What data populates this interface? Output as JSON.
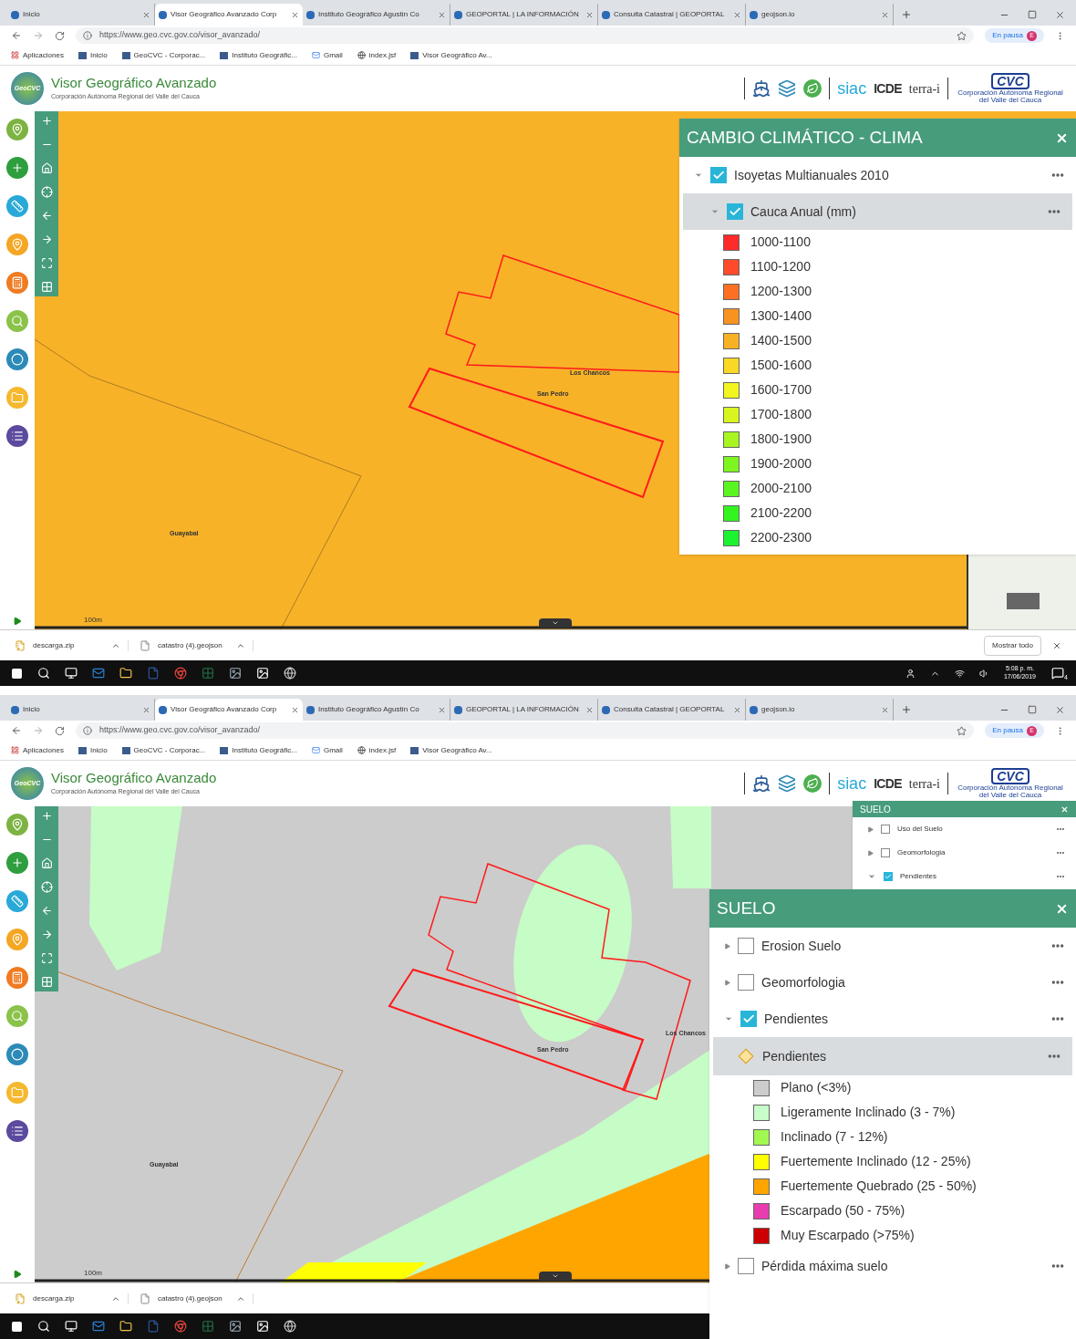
{
  "screens": [
    {
      "tabs": [
        {
          "label": "Inicio",
          "selected": false
        },
        {
          "label": "Visor Geográfico Avanzado Corp",
          "selected": true
        },
        {
          "label": "Instituto Geográfico Agustín Co",
          "selected": false
        },
        {
          "label": "GEOPORTAL | LA INFORMACIÓN",
          "selected": false
        },
        {
          "label": "Consulta Catastral | GEOPORTAL",
          "selected": false
        },
        {
          "label": "geojson.io",
          "selected": false
        }
      ],
      "url": "https://www.geo.cvc.gov.co/visor_avanzado/",
      "pause_label": "En pausa",
      "profile_initial": "E",
      "bookmarks": [
        "Aplicaciones",
        "Inicio",
        "GeoCVC - Corporac...",
        "Instituto Geográfic...",
        "Gmail",
        "index.jsf",
        "Visor Geográfico Av..."
      ],
      "app": {
        "logo_text": "GeoCVC",
        "title": "Visor Geográfico Avanzado",
        "subtitle": "Corporación Autónoma Regional del Valle del Cauca",
        "partners": [
          "siac",
          "ICDE",
          "terra-i",
          "CVC"
        ],
        "cvc_caption": "Corporación Autónoma Regional del Valle del Cauca"
      },
      "map": {
        "kind": "rainfall",
        "labels": [
          "Los Chancos",
          "San Pedro",
          "Guayabal"
        ],
        "scale": "100m"
      },
      "panels": [
        {
          "kind": "full",
          "title": "CAMBIO CLIMÁTICO - CLIMA",
          "items": [
            {
              "kind": "layer",
              "label": "Isoyetas Multianuales 2010",
              "checked": true,
              "expanded": true,
              "highlighted": false,
              "children": [
                {
                  "kind": "layer",
                  "label": "Cauca Anual (mm)",
                  "checked": true,
                  "expanded": true,
                  "highlighted": true,
                  "children": [
                    {
                      "kind": "swatch",
                      "label": "1000-1100",
                      "color": "#ff2a2a"
                    },
                    {
                      "kind": "swatch",
                      "label": "1100-1200",
                      "color": "#ff4a2c"
                    },
                    {
                      "kind": "swatch",
                      "label": "1200-1300",
                      "color": "#fc7023"
                    },
                    {
                      "kind": "swatch",
                      "label": "1300-1400",
                      "color": "#f8931f"
                    },
                    {
                      "kind": "swatch",
                      "label": "1400-1500",
                      "color": "#f8b124"
                    },
                    {
                      "kind": "swatch",
                      "label": "1500-1600",
                      "color": "#fbd824"
                    },
                    {
                      "kind": "swatch",
                      "label": "1600-1700",
                      "color": "#f2f520"
                    },
                    {
                      "kind": "swatch",
                      "label": "1700-1800",
                      "color": "#d9f520"
                    },
                    {
                      "kind": "swatch",
                      "label": "1800-1900",
                      "color": "#a8f520"
                    },
                    {
                      "kind": "swatch",
                      "label": "1900-2000",
                      "color": "#7ef520"
                    },
                    {
                      "kind": "swatch",
                      "label": "2000-2100",
                      "color": "#5af520"
                    },
                    {
                      "kind": "swatch",
                      "label": "2100-2200",
                      "color": "#32f520"
                    },
                    {
                      "kind": "swatch",
                      "label": "2200-2300",
                      "color": "#1cf230"
                    }
                  ]
                }
              ]
            }
          ]
        }
      ],
      "downloads": {
        "files": [
          "descarga.zip",
          "catastro (4).geojson"
        ],
        "show_all": "Mostrar todo"
      },
      "taskbar": {
        "time": "5:08 p. m.",
        "date": "17/06/2019",
        "notifications": "4"
      }
    },
    {
      "tabs": [
        {
          "label": "Inicio",
          "selected": false
        },
        {
          "label": "Visor Geográfico Avanzado Corp",
          "selected": true
        },
        {
          "label": "Instituto Geográfico Agustín Co",
          "selected": false
        },
        {
          "label": "GEOPORTAL | LA INFORMACIÓN",
          "selected": false
        },
        {
          "label": "Consulta Catastral | GEOPORTAL",
          "selected": false
        },
        {
          "label": "geojson.io",
          "selected": false
        }
      ],
      "url": "https://www.geo.cvc.gov.co/visor_avanzado/",
      "pause_label": "En pausa",
      "profile_initial": "E",
      "bookmarks": [
        "Aplicaciones",
        "Inicio",
        "GeoCVC - Corporac...",
        "Instituto Geográfic...",
        "Gmail",
        "index.jsf",
        "Visor Geográfico Av..."
      ],
      "app": {
        "logo_text": "GeoCVC",
        "title": "Visor Geográfico Avanzado",
        "subtitle": "Corporación Autónoma Regional del Valle del Cauca",
        "partners": [
          "siac",
          "ICDE",
          "terra-i",
          "CVC"
        ],
        "cvc_caption": "Corporación Autónoma Regional del Valle del Cauca"
      },
      "map": {
        "kind": "slope",
        "labels": [
          "Los Chancos",
          "San Pedro",
          "Guayabal"
        ],
        "scale": "100m"
      },
      "panels": [
        {
          "kind": "compact",
          "title": "SUELO",
          "items": [
            {
              "kind": "layer",
              "label": "Uso del Suelo",
              "checked": false,
              "expanded": false,
              "highlighted": false
            },
            {
              "kind": "layer",
              "label": "Geomorfologia",
              "checked": false,
              "expanded": false,
              "highlighted": false
            },
            {
              "kind": "layer",
              "label": "Pendientes",
              "checked": true,
              "expanded": true,
              "highlighted": false
            }
          ]
        },
        {
          "kind": "full",
          "title": "SUELO",
          "items": [
            {
              "kind": "layer",
              "label": "Erosion Suelo",
              "checked": false,
              "expanded": false,
              "highlighted": false
            },
            {
              "kind": "layer",
              "label": "Geomorfologia",
              "checked": false,
              "expanded": false,
              "highlighted": false
            },
            {
              "kind": "layer",
              "label": "Pendientes",
              "checked": true,
              "expanded": true,
              "highlighted": false,
              "children": [
                {
                  "kind": "symbol",
                  "label": "Pendientes",
                  "highlighted": true,
                  "children": [
                    {
                      "kind": "swatch",
                      "label": "Plano (<3%)",
                      "color": "#cccccc"
                    },
                    {
                      "kind": "swatch",
                      "label": "Ligeramente Inclinado (3 - 7%)",
                      "color": "#c8fcc8"
                    },
                    {
                      "kind": "swatch",
                      "label": "Inclinado (7 - 12%)",
                      "color": "#a0f850"
                    },
                    {
                      "kind": "swatch",
                      "label": "Fuertemente Inclinado (12 - 25%)",
                      "color": "#ffff00"
                    },
                    {
                      "kind": "swatch",
                      "label": "Fuertemente Quebrado (25 - 50%)",
                      "color": "#ffa500"
                    },
                    {
                      "kind": "swatch",
                      "label": "Escarpado (50 - 75%)",
                      "color": "#e83cb0"
                    },
                    {
                      "kind": "swatch",
                      "label": "Muy Escarpado (>75%)",
                      "color": "#cc0000"
                    }
                  ]
                }
              ]
            },
            {
              "kind": "layer",
              "label": "Pérdida máxima suelo",
              "checked": false,
              "expanded": false,
              "highlighted": false
            }
          ]
        }
      ],
      "downloads": {
        "files": [
          "descarga.zip",
          "catastro (4).geojson"
        ]
      }
    }
  ]
}
